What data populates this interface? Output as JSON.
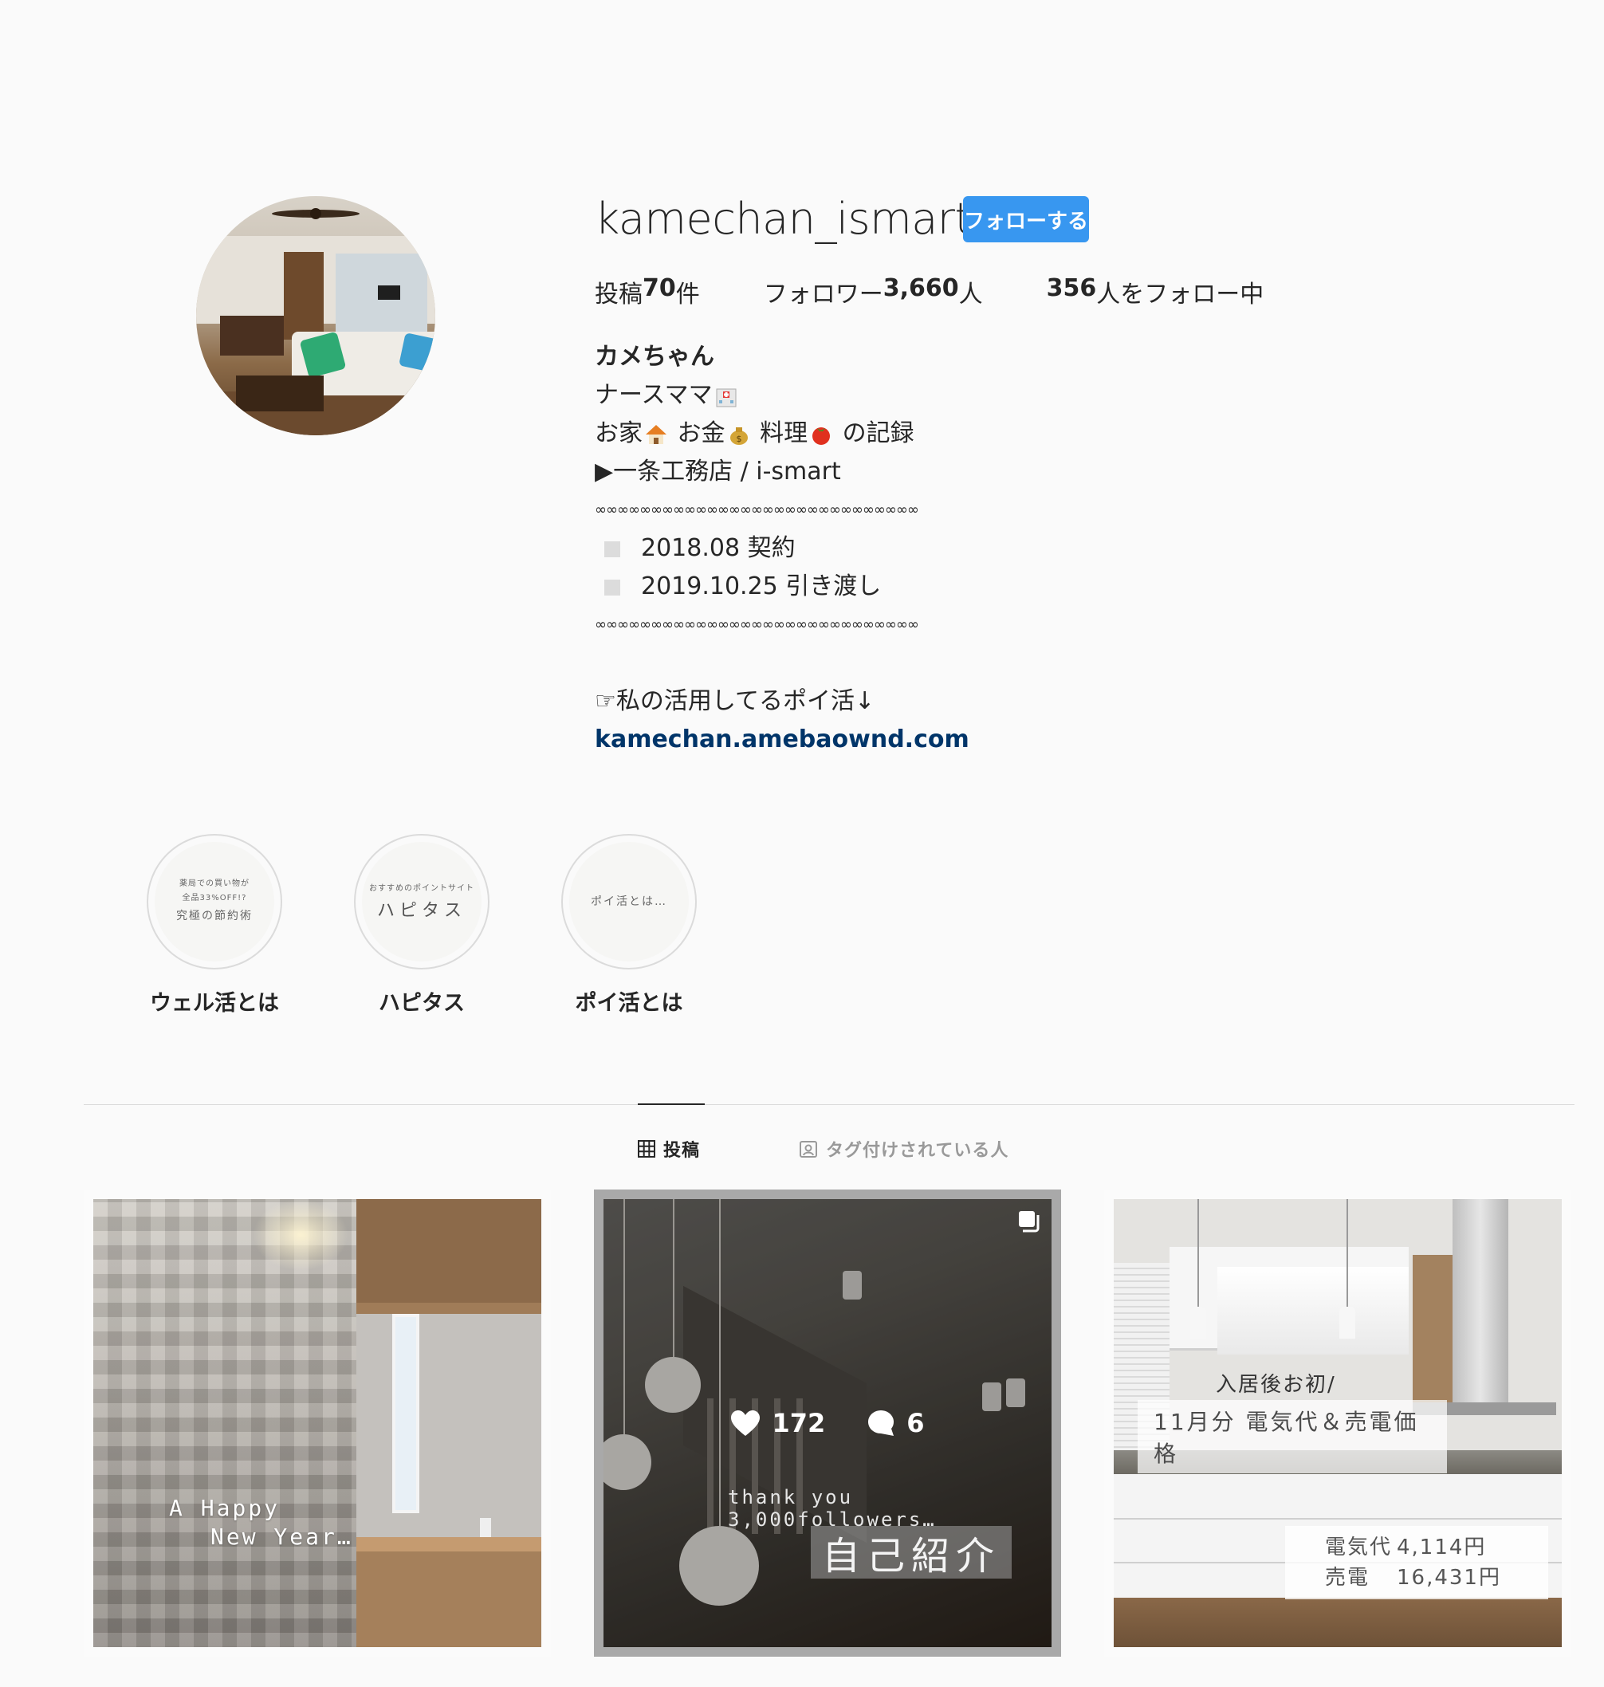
{
  "profile": {
    "username": "kamechan_ismart",
    "follow_label": "フォローする",
    "stats": {
      "posts": {
        "prefix": "投稿",
        "value": "70",
        "suffix": "件"
      },
      "followers": {
        "prefix": "フォロワー",
        "value": "3,660",
        "suffix": "人"
      },
      "following": {
        "prefix": "",
        "value": "356",
        "suffix": "人をフォロー中"
      }
    },
    "bio": {
      "name": "カメちゃん",
      "line1": "ナースママ",
      "line2_a": "お家",
      "line2_b": " お金",
      "line2_c": " 料理",
      "line2_d": " の記録",
      "line3": "▶︎一条工務店 / i-smart",
      "separator": "∞∞∞∞∞∞∞∞∞∞∞∞∞∞∞∞∞∞∞∞∞∞∞∞∞∞∞∞∞",
      "item1": "2018.08 契約",
      "item2": "2019.10.25 引き渡し",
      "poi_line": "☞私の活用してるポイ活↓",
      "link": "kamechan.amebaownd.com"
    }
  },
  "highlights": [
    {
      "label": "ウェル活とは",
      "cover_small1": "薬局での買い物が",
      "cover_small2": "全品33%OFF!?",
      "cover_mid": "究極の節約術"
    },
    {
      "label": "ハピタス",
      "cover_small1": "おすすめのポイントサイト",
      "cover_big": "ハピタス"
    },
    {
      "label": "ポイ活とは",
      "cover_mid": "ポイ活とは…"
    }
  ],
  "tabs": {
    "posts": "投稿",
    "tagged": "タグ付けされている人"
  },
  "posts": [
    {
      "caption_line1": "A Happy",
      "caption_line2": "New Year…"
    },
    {
      "likes": "172",
      "comments": "6",
      "caption": "thank you 3,000followers…",
      "title": "自己紹介"
    },
    {
      "title1": "入居後お初/",
      "title2": "11月分 電気代＆売電価格",
      "label_a": "電気代",
      "value_a": "4,114円",
      "label_b": "売電",
      "value_b": "16,431円"
    }
  ],
  "colors": {
    "follow_button": "#3897f0",
    "link": "#003569",
    "background": "#fafafa"
  }
}
